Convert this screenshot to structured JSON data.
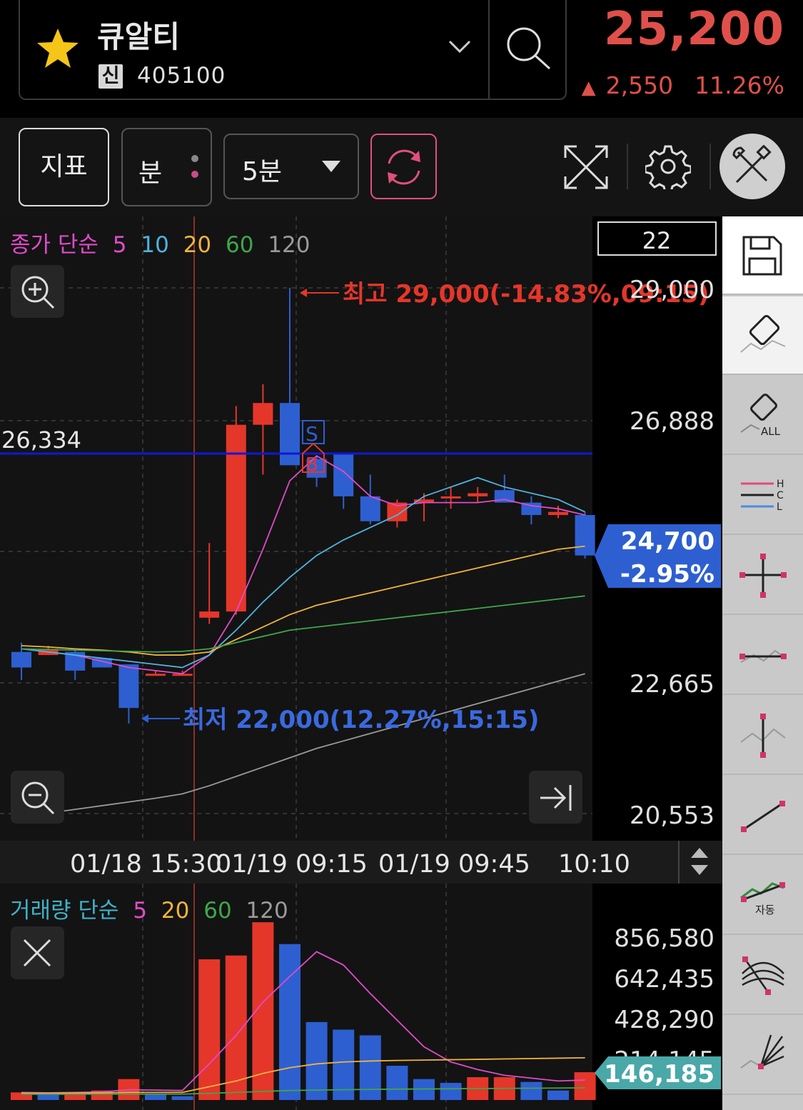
{
  "header": {
    "stock_name": "큐알티",
    "badge": "신",
    "stock_code": "405100",
    "price": "25,200",
    "change_arrow": "▲",
    "change": "2,550",
    "change_pct": "11.26%"
  },
  "toolbar": {
    "indicator_label": "지표",
    "period_label": "분",
    "interval_label": "5분"
  },
  "price_chart": {
    "legend": {
      "prefix": "종가 단순",
      "ma": [
        "5",
        "10",
        "20",
        "60",
        "120"
      ]
    },
    "count_box": "22",
    "y_ticks": [
      "29,000",
      "26,888",
      "22,665",
      "20,553"
    ],
    "ref_line_label": "26,334",
    "high_label": "최고 29,000(-14.83%,09:15)",
    "low_label": "최저 22,000(12.27%,15:15)",
    "current_price": "24,700",
    "current_pct": "-2.95%",
    "marker_s": "S",
    "marker_b": "B",
    "x_ticks": [
      "01/18 15:30",
      "01/19 09:15",
      "01/19 09:45",
      "10:10"
    ]
  },
  "volume_chart": {
    "legend": {
      "prefix": "거래량 단순",
      "ma": [
        "5",
        "20",
        "60",
        "120"
      ]
    },
    "y_ticks": [
      "856,580",
      "642,435",
      "428,290",
      "214,145"
    ],
    "current_volume": "146,185"
  },
  "chart_data": [
    {
      "type": "candlestick",
      "title": "",
      "ylim": [
        20553,
        29000
      ],
      "candles": [
        {
          "o": 23150,
          "h": 23300,
          "l": 22700,
          "c": 22900
        },
        {
          "o": 23100,
          "h": 23250,
          "l": 23100,
          "c": 23200
        },
        {
          "o": 23150,
          "h": 23200,
          "l": 22700,
          "c": 22850
        },
        {
          "o": 23050,
          "h": 23050,
          "l": 22900,
          "c": 22900
        },
        {
          "o": 22950,
          "h": 22950,
          "l": 22000,
          "c": 22250
        },
        {
          "o": 22800,
          "h": 22850,
          "l": 22800,
          "c": 22800
        },
        {
          "o": 22800,
          "h": 22850,
          "l": 22800,
          "c": 22800
        },
        {
          "o": 23700,
          "h": 24900,
          "l": 23600,
          "c": 23800
        },
        {
          "o": 23800,
          "h": 27100,
          "l": 23750,
          "c": 26800
        },
        {
          "o": 26800,
          "h": 27450,
          "l": 26000,
          "c": 27150
        },
        {
          "o": 27150,
          "h": 29000,
          "l": 26250,
          "c": 26150
        },
        {
          "o": 26250,
          "h": 26300,
          "l": 25800,
          "c": 25950
        },
        {
          "o": 26350,
          "h": 26350,
          "l": 25450,
          "c": 25650
        },
        {
          "o": 25650,
          "h": 26000,
          "l": 25200,
          "c": 25250
        },
        {
          "o": 25250,
          "h": 25600,
          "l": 25150,
          "c": 25550
        },
        {
          "o": 25550,
          "h": 25700,
          "l": 25250,
          "c": 25600
        },
        {
          "o": 25650,
          "h": 25800,
          "l": 25450,
          "c": 25650
        },
        {
          "o": 25650,
          "h": 25800,
          "l": 25550,
          "c": 25700
        },
        {
          "o": 25750,
          "h": 26000,
          "l": 25550,
          "c": 25550
        },
        {
          "o": 25550,
          "h": 25650,
          "l": 25200,
          "c": 25350
        },
        {
          "o": 25350,
          "h": 25500,
          "l": 25300,
          "c": 25400
        },
        {
          "o": 25350,
          "h": 25400,
          "l": 24650,
          "c": 24700
        }
      ],
      "series": [
        {
          "name": "5",
          "values": [
            23200,
            23150,
            23100,
            23000,
            22900,
            22850,
            22800,
            23100,
            23800,
            24800,
            25900,
            26300,
            26050,
            25650,
            25500,
            25550,
            25550,
            25550,
            25600,
            25500,
            25450,
            25350
          ]
        },
        {
          "name": "10",
          "values": [
            23200,
            23150,
            23100,
            23050,
            23000,
            22950,
            22900,
            23100,
            23500,
            23950,
            24350,
            24700,
            24950,
            25150,
            25350,
            25650,
            25800,
            25950,
            25800,
            25700,
            25600,
            25400
          ]
        },
        {
          "name": "20",
          "values": [
            23250,
            23230,
            23200,
            23180,
            23150,
            23100,
            23100,
            23150,
            23350,
            23550,
            23750,
            23900,
            24000,
            24100,
            24200,
            24300,
            24400,
            24500,
            24600,
            24700,
            24800,
            24850
          ]
        },
        {
          "name": "60",
          "values": [
            23200,
            23190,
            23180,
            23170,
            23160,
            23150,
            23160,
            23200,
            23300,
            23400,
            23500,
            23550,
            23600,
            23650,
            23700,
            23750,
            23800,
            23850,
            23900,
            23950,
            24000,
            24050
          ]
        },
        {
          "name": "120",
          "values": [
            20500,
            20560,
            20620,
            20680,
            20740,
            20800,
            20870,
            21000,
            21150,
            21300,
            21450,
            21600,
            21720,
            21840,
            21960,
            22080,
            22200,
            22320,
            22440,
            22560,
            22680,
            22800
          ]
        }
      ]
    },
    {
      "type": "bar",
      "title": "",
      "ylim": [
        0,
        856580
      ],
      "values": [
        40000,
        30000,
        40000,
        50000,
        110000,
        30000,
        20000,
        740000,
        760000,
        935000,
        820000,
        410000,
        370000,
        340000,
        180000,
        110000,
        90000,
        120000,
        120000,
        95000,
        50000,
        146185
      ],
      "colors": [
        "up",
        "down",
        "up",
        "up",
        "up",
        "down",
        "down",
        "up",
        "up",
        "up",
        "down",
        "down",
        "down",
        "down",
        "down",
        "down",
        "down",
        "up",
        "up",
        "down",
        "down",
        "up"
      ],
      "series": [
        {
          "name": "5",
          "values": [
            40000,
            38000,
            40000,
            42000,
            54000,
            52000,
            50000,
            190000,
            340000,
            515000,
            650000,
            780000,
            710000,
            560000,
            420000,
            280000,
            200000,
            160000,
            130000,
            115000,
            100000,
            105000
          ]
        },
        {
          "name": "20",
          "values": [
            35000,
            35000,
            36000,
            37000,
            40000,
            40000,
            40000,
            70000,
            100000,
            140000,
            170000,
            190000,
            200000,
            205000,
            208000,
            210000,
            212000,
            214000,
            216000,
            218000,
            220000,
            222000
          ]
        },
        {
          "name": "60",
          "values": [
            30000,
            30000,
            30000,
            31000,
            31000,
            31000,
            31000,
            35000,
            40000,
            45000,
            50000,
            52000,
            54000,
            56000,
            57000,
            58000,
            59000,
            60000,
            61000,
            62000,
            63000,
            64000
          ]
        }
      ]
    }
  ],
  "colors": {
    "up": "#e5362a",
    "down": "#2e5fd1",
    "ma5": "#e04bc9",
    "ma10": "#4fb3e0",
    "ma20": "#f0b43c",
    "ma60": "#3fa64a",
    "ma120": "#9a9a9a",
    "ref_line": "#1018d8",
    "accent": "#e0504a"
  },
  "icons": [
    "star-icon",
    "chevron-down-icon",
    "search-icon",
    "refresh-icon",
    "expand-icon",
    "gear-icon",
    "tools-icon",
    "zoom-in-icon",
    "zoom-out-icon",
    "scroll-end-icon",
    "close-icon",
    "save-icon",
    "eraser-icon",
    "eraser-all-icon",
    "hcl-icon",
    "crosshair-icon",
    "horizontal-line-icon",
    "vertical-line-icon",
    "trend-line-icon",
    "auto-trend-icon",
    "fibonacci-arc-icon",
    "fan-line-icon"
  ],
  "side_tools": {
    "eraser_all_label": "ALL",
    "hcl_labels": [
      "H",
      "C",
      "L"
    ],
    "auto_label": "자동"
  }
}
